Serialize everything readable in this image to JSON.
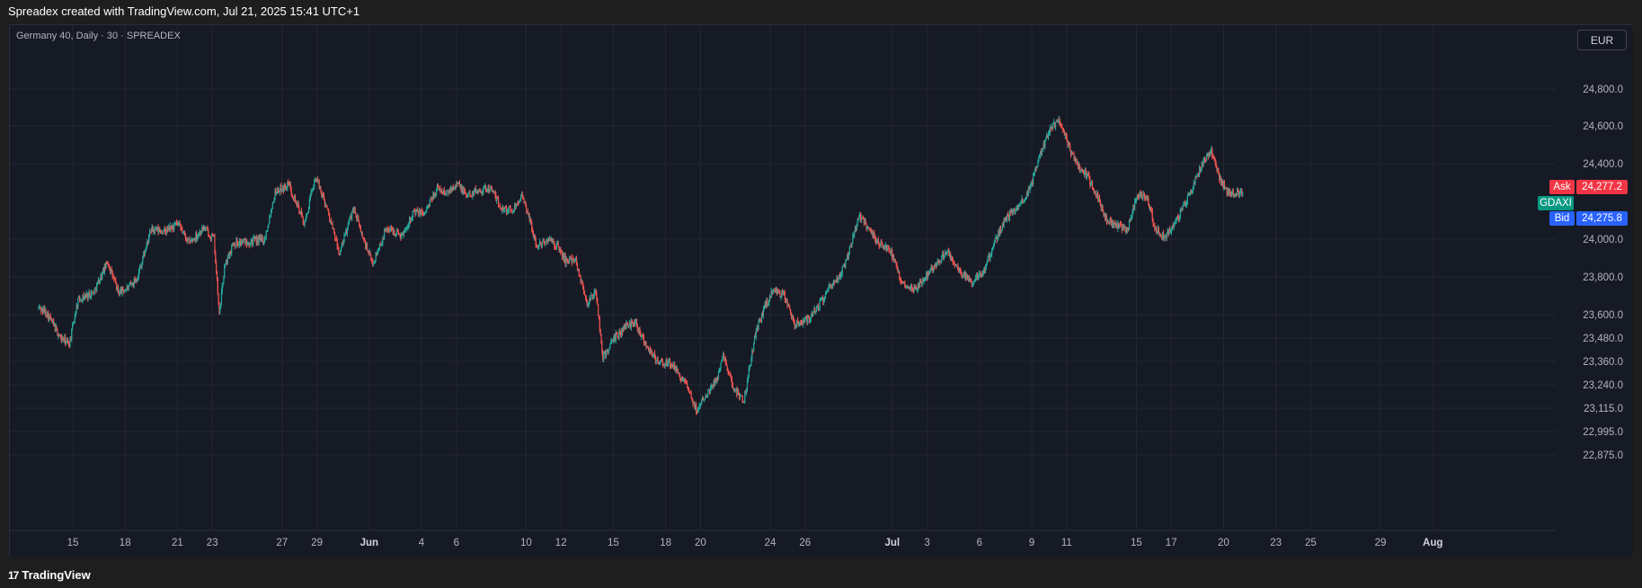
{
  "header": {
    "text": "Spreadex created with TradingView.com, Jul 21, 2025 15:41 UTC+1"
  },
  "symbol": {
    "title": "Germany 40, Daily · 30 · SPREADEX"
  },
  "currency": {
    "label": "EUR"
  },
  "footer": {
    "brand": "TradingView",
    "logo_mark": "17"
  },
  "quotes": {
    "ask_label": "Ask",
    "ask_value": "24,277.2",
    "symbol_label": "GDAXI",
    "bid_label": "Bid",
    "bid_value": "24,275.8"
  },
  "colors": {
    "up": "#26a69a",
    "down": "#ef5350",
    "ask_bg": "#f23645",
    "bid_bg": "#2962ff",
    "symbol_bg": "#089981",
    "grid": "#232733",
    "background": "#161a25"
  },
  "chart_data": {
    "type": "candlestick",
    "title": "Germany 40, Daily · 30 · SPREADEX",
    "y_ticks": [
      "24,800.0",
      "24,600.0",
      "24,400.0",
      "24,000.0",
      "23,800.0",
      "23,600.0",
      "23,480.0",
      "23,360.0",
      "23,240.0",
      "23,115.0",
      "22,995.0",
      "22,875.0"
    ],
    "y_tick_values": [
      24800,
      24600,
      24400,
      24000,
      23800,
      23600,
      23480,
      23360,
      23240,
      23115,
      22995,
      22875
    ],
    "x_ticks": [
      {
        "label": "15",
        "day": 15
      },
      {
        "label": "18",
        "day": 18
      },
      {
        "label": "21",
        "day": 21
      },
      {
        "label": "23",
        "day": 23
      },
      {
        "label": "27",
        "day": 27
      },
      {
        "label": "29",
        "day": 29
      },
      {
        "label": "Jun",
        "day": 32,
        "bold": true
      },
      {
        "label": "4",
        "day": 35
      },
      {
        "label": "6",
        "day": 37
      },
      {
        "label": "10",
        "day": 41
      },
      {
        "label": "12",
        "day": 43
      },
      {
        "label": "15",
        "day": 46
      },
      {
        "label": "18",
        "day": 49
      },
      {
        "label": "20",
        "day": 51
      },
      {
        "label": "24",
        "day": 55
      },
      {
        "label": "26",
        "day": 57
      },
      {
        "label": "Jul",
        "day": 62,
        "bold": true
      },
      {
        "label": "3",
        "day": 64
      },
      {
        "label": "6",
        "day": 67
      },
      {
        "label": "9",
        "day": 70
      },
      {
        "label": "11",
        "day": 72
      },
      {
        "label": "15",
        "day": 76
      },
      {
        "label": "17",
        "day": 78
      },
      {
        "label": "20",
        "day": 81
      },
      {
        "label": "23",
        "day": 84
      },
      {
        "label": "25",
        "day": 86
      },
      {
        "label": "29",
        "day": 90
      },
      {
        "label": "Aug",
        "day": 93,
        "bold": true
      }
    ],
    "last_price": 24276.5,
    "path": [
      [
        13,
        23640
      ],
      [
        13.5,
        23610
      ],
      [
        14.3,
        23480
      ],
      [
        14.8,
        23450
      ],
      [
        15.3,
        23680
      ],
      [
        16.2,
        23720
      ],
      [
        17.0,
        23880
      ],
      [
        17.6,
        23720
      ],
      [
        18.2,
        23740
      ],
      [
        18.7,
        23800
      ],
      [
        19.5,
        24050
      ],
      [
        20.3,
        24040
      ],
      [
        21.0,
        24080
      ],
      [
        21.7,
        23980
      ],
      [
        22.5,
        24060
      ],
      [
        23.1,
        24000
      ],
      [
        23.4,
        23600
      ],
      [
        23.7,
        23850
      ],
      [
        24.2,
        23980
      ],
      [
        25.3,
        23990
      ],
      [
        26.0,
        24000
      ],
      [
        26.6,
        24250
      ],
      [
        27.4,
        24290
      ],
      [
        28.3,
        24080
      ],
      [
        28.9,
        24330
      ],
      [
        29.5,
        24190
      ],
      [
        30.3,
        23920
      ],
      [
        31.1,
        24170
      ],
      [
        31.7,
        23990
      ],
      [
        32.2,
        23870
      ],
      [
        33.0,
        24060
      ],
      [
        33.9,
        24020
      ],
      [
        34.5,
        24140
      ],
      [
        35.2,
        24140
      ],
      [
        35.9,
        24270
      ],
      [
        36.4,
        24240
      ],
      [
        37.0,
        24300
      ],
      [
        37.6,
        24230
      ],
      [
        38.2,
        24260
      ],
      [
        39.0,
        24270
      ],
      [
        39.5,
        24170
      ],
      [
        40.2,
        24150
      ],
      [
        40.7,
        24230
      ],
      [
        41.1,
        24140
      ],
      [
        41.6,
        23960
      ],
      [
        42.3,
        24000
      ],
      [
        42.8,
        23960
      ],
      [
        43.3,
        23880
      ],
      [
        43.8,
        23900
      ],
      [
        44.5,
        23660
      ],
      [
        45.0,
        23720
      ],
      [
        45.4,
        23380
      ],
      [
        46.1,
        23480
      ],
      [
        46.8,
        23550
      ],
      [
        47.3,
        23560
      ],
      [
        47.8,
        23460
      ],
      [
        48.6,
        23350
      ],
      [
        49.3,
        23350
      ],
      [
        50.1,
        23250
      ],
      [
        50.8,
        23100
      ],
      [
        51.2,
        23180
      ],
      [
        51.9,
        23260
      ],
      [
        52.3,
        23400
      ],
      [
        52.9,
        23220
      ],
      [
        53.5,
        23160
      ],
      [
        54.1,
        23480
      ],
      [
        54.7,
        23650
      ],
      [
        55.2,
        23730
      ],
      [
        55.8,
        23700
      ],
      [
        56.4,
        23550
      ],
      [
        57.2,
        23580
      ],
      [
        57.8,
        23650
      ],
      [
        58.4,
        23740
      ],
      [
        59.0,
        23800
      ],
      [
        59.6,
        23960
      ],
      [
        60.1,
        24130
      ],
      [
        60.7,
        24050
      ],
      [
        61.2,
        23980
      ],
      [
        61.9,
        23940
      ],
      [
        62.5,
        23770
      ],
      [
        63.3,
        23740
      ],
      [
        64.0,
        23810
      ],
      [
        64.6,
        23880
      ],
      [
        65.2,
        23930
      ],
      [
        65.9,
        23820
      ],
      [
        66.6,
        23770
      ],
      [
        67.3,
        23840
      ],
      [
        67.9,
        23990
      ],
      [
        68.5,
        24110
      ],
      [
        69.2,
        24170
      ],
      [
        69.9,
        24260
      ],
      [
        70.4,
        24430
      ],
      [
        71.0,
        24580
      ],
      [
        71.6,
        24630
      ],
      [
        72.2,
        24470
      ],
      [
        72.7,
        24380
      ],
      [
        73.2,
        24330
      ],
      [
        73.8,
        24220
      ],
      [
        74.3,
        24100
      ],
      [
        74.8,
        24070
      ],
      [
        75.5,
        24050
      ],
      [
        76.0,
        24230
      ],
      [
        76.6,
        24230
      ],
      [
        77.1,
        24050
      ],
      [
        77.6,
        24010
      ],
      [
        78.2,
        24080
      ],
      [
        78.8,
        24190
      ],
      [
        79.2,
        24270
      ],
      [
        79.8,
        24410
      ],
      [
        80.3,
        24470
      ],
      [
        80.8,
        24320
      ],
      [
        81.1,
        24260
      ],
      [
        81.6,
        24240
      ],
      [
        82.1,
        24250
      ]
    ]
  }
}
